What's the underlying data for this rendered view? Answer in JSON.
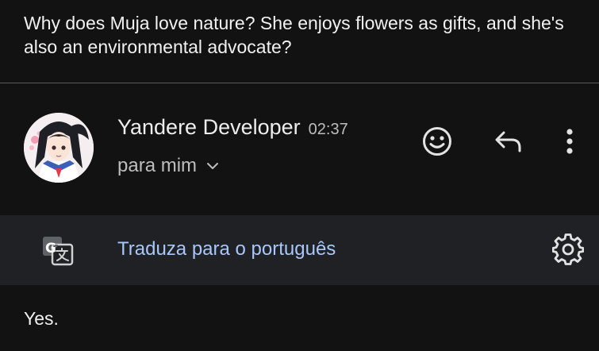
{
  "message": {
    "question": "Why does Muja love nature? She enjoys flowers as gifts, and she's also an environmental advocate?"
  },
  "header": {
    "sender_name": "Yandere Developer",
    "time": "02:37",
    "recipient": "para mim"
  },
  "actions": {
    "emoji_icon": "smiley-icon",
    "reply_icon": "reply-arrow-icon",
    "more_icon": "vertical-dots-icon"
  },
  "translate_bar": {
    "icon": "google-translate-icon",
    "link": "Traduza para o português",
    "settings_icon": "gear-icon"
  },
  "reply": {
    "body": "Yes."
  },
  "colors": {
    "background": "#121212",
    "bar_background": "#202124",
    "link": "#a8c7fa",
    "text": "#e3e3e3"
  }
}
